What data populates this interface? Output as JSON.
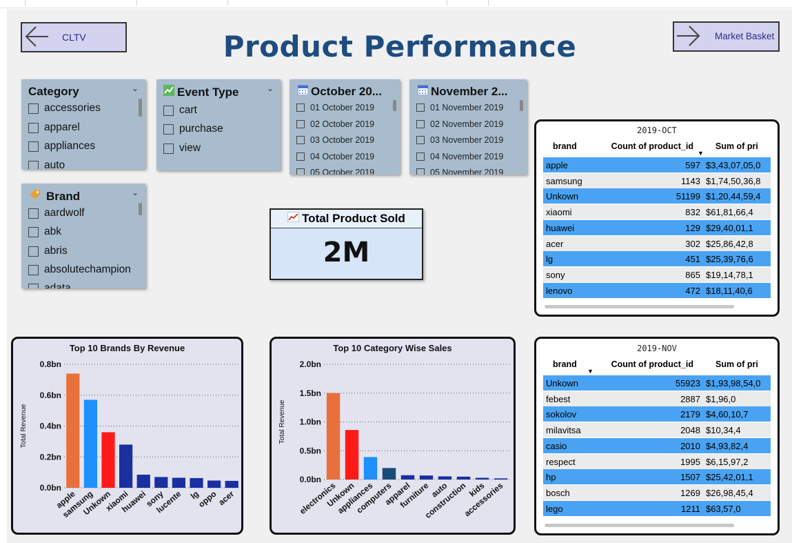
{
  "nav": {
    "back_label": "CLTV",
    "forward_label": "Market Basket"
  },
  "page_title": "Product Performance",
  "slicers": {
    "category": {
      "title": "Category",
      "items": [
        "accessories",
        "apparel",
        "appliances",
        "auto"
      ]
    },
    "event_type": {
      "title": "Event Type",
      "icon": "chart-icon",
      "items": [
        "cart",
        "purchase",
        "view"
      ]
    },
    "october": {
      "title": "October 20...",
      "icon": "calendar-icon",
      "items": [
        "01 October 2019",
        "02 October 2019",
        "03 October 2019",
        "04 October 2019",
        "05 October 2019"
      ]
    },
    "november": {
      "title": "November 2...",
      "icon": "calendar-icon",
      "items": [
        "01 November 2019",
        "02 November 2019",
        "03 November 2019",
        "04 November 2019",
        "05 November 2019"
      ]
    },
    "brand": {
      "title": "Brand",
      "icon": "tag-icon",
      "items": [
        "aardwolf",
        "abk",
        "abris",
        "absolutechampion",
        "adata"
      ]
    }
  },
  "kpi": {
    "title": "Total Product Sold",
    "icon": "trend-icon",
    "value": "2M"
  },
  "tables": {
    "oct": {
      "title": "2019-OCT",
      "headers": [
        "brand",
        "Count of product_id",
        "Sum of pri"
      ],
      "rows": [
        [
          "apple",
          "597",
          "$3,43,07,05,0"
        ],
        [
          "samsung",
          "1143",
          "$1,74,50,36,8"
        ],
        [
          "Unkown",
          "51199",
          "$1,20,44,59,4"
        ],
        [
          "xiaomi",
          "832",
          "$61,81,66,4"
        ],
        [
          "huawei",
          "129",
          "$29,40,01,1"
        ],
        [
          "acer",
          "302",
          "$25,86,42,8"
        ],
        [
          "lg",
          "451",
          "$25,39,76,6"
        ],
        [
          "sony",
          "865",
          "$19,14,78,1"
        ],
        [
          "lenovo",
          "472",
          "$18,11,40,6"
        ]
      ]
    },
    "nov": {
      "title": "2019-NOV",
      "headers": [
        "brand",
        "Count of product_id",
        "Sum of pri"
      ],
      "rows": [
        [
          "Unkown",
          "55923",
          "$1,93,98,54,0"
        ],
        [
          "febest",
          "2887",
          "$1,96,0"
        ],
        [
          "sokolov",
          "2179",
          "$4,60,10,7"
        ],
        [
          "milavitsa",
          "2048",
          "$10,34,4"
        ],
        [
          "casio",
          "2010",
          "$4,93,82,4"
        ],
        [
          "respect",
          "1995",
          "$6,15,97,2"
        ],
        [
          "hp",
          "1507",
          "$25,42,01,1"
        ],
        [
          "bosch",
          "1269",
          "$26,98,45,4"
        ],
        [
          "lego",
          "1211",
          "$63,57,0"
        ]
      ]
    }
  },
  "chart_data": [
    {
      "type": "bar",
      "title": "Top 10 Brands By Revenue",
      "xlabel": "",
      "ylabel": "Total Revenue",
      "ylim": [
        0,
        0.8
      ],
      "yticks": [
        "0.0bn",
        "0.2bn",
        "0.4bn",
        "0.6bn",
        "0.8bn"
      ],
      "grid": true,
      "categories": [
        "apple",
        "samsung",
        "Unkown",
        "xiaomi",
        "huawei",
        "sony",
        "lucente",
        "lg",
        "oppo",
        "acer"
      ],
      "values": [
        0.74,
        0.57,
        0.36,
        0.28,
        0.085,
        0.07,
        0.065,
        0.063,
        0.047,
        0.045
      ],
      "colors": [
        "#e8703a",
        "#1e90ff",
        "#ff1a1a",
        "#1a2fa0",
        "#1a2fa0",
        "#1a2fa0",
        "#1a2fa0",
        "#1a2fa0",
        "#1a2fa0",
        "#1a2fa0"
      ]
    },
    {
      "type": "bar",
      "title": "Top 10 Category Wise Sales",
      "xlabel": "",
      "ylabel": "Total Revenue",
      "ylim": [
        0,
        2.0
      ],
      "yticks": [
        "0.0bn",
        "0.5bn",
        "1.0bn",
        "1.5bn",
        "2.0bn"
      ],
      "grid": true,
      "categories": [
        "electronics",
        "Unkown",
        "appliances",
        "computers",
        "apparel",
        "furniture",
        "auto",
        "construction",
        "kids",
        "accessories"
      ],
      "values": [
        1.5,
        0.86,
        0.39,
        0.2,
        0.075,
        0.07,
        0.055,
        0.05,
        0.03,
        0.02
      ],
      "colors": [
        "#e8703a",
        "#ff1a1a",
        "#1e90ff",
        "#1a4a7a",
        "#1a2fa0",
        "#1a2fa0",
        "#1a2fa0",
        "#1a2fa0",
        "#1a2fa0",
        "#1a2fa0"
      ]
    }
  ]
}
